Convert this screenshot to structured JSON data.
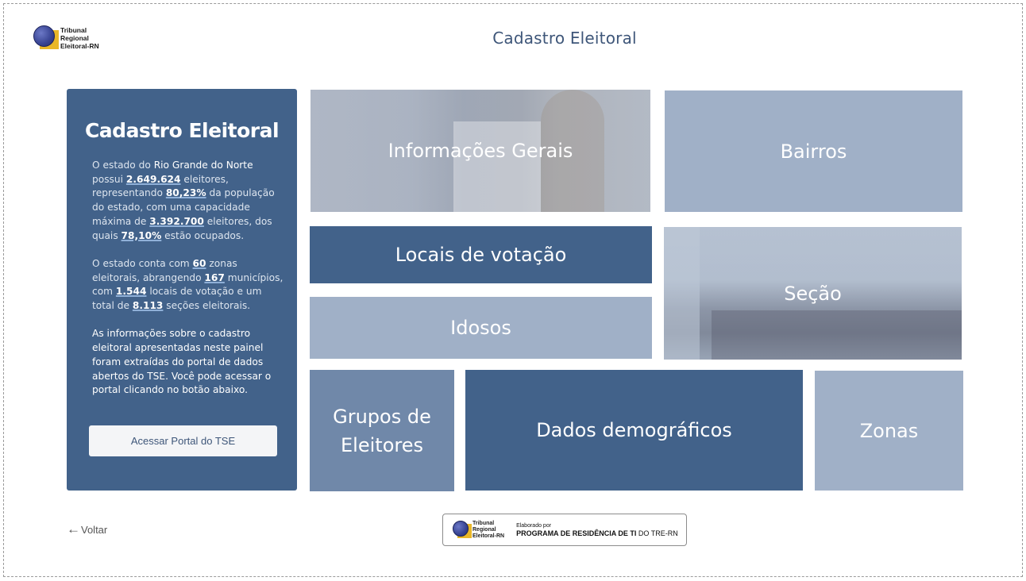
{
  "header": {
    "logo_lines": [
      "Tribunal",
      "Regional",
      "Eleitoral-RN"
    ],
    "title": "Cadastro Eleitoral"
  },
  "info_panel": {
    "title": "Cadastro Eleitoral",
    "p1": {
      "t1": "O estado do ",
      "state": "Rio Grande do Norte",
      "t2": " possui ",
      "voters": "2.649.624",
      "t3": " eleitores, representando ",
      "pct_population": "80,23%",
      "t4": " da população do estado, com uma capacidade máxima de ",
      "capacity": "3.392.700",
      "t5": " eleitores, dos quais ",
      "pct_occupied": "78,10%",
      "t6": " estão ocupados."
    },
    "p2": {
      "t1": "O estado conta com ",
      "zones": "60",
      "t2": " zonas eleitorais, abrangendo ",
      "municipalities": "167",
      "t3": " municípios, com ",
      "locations": "1.544",
      "t4": " locais de votação e um total de ",
      "sections": "8.113",
      "t5": " seções eleitorais."
    },
    "p3": "As informações sobre o cadastro eleitoral apresentadas neste painel foram extraídas do portal de dados abertos do TSE. Você pode acessar o portal clicando no botão abaixo.",
    "button_label": "Acessar Portal do TSE"
  },
  "tiles": {
    "informacoes_gerais": "Informações Gerais",
    "bairros": "Bairros",
    "locais_votacao": "Locais de votação",
    "secao": "Seção",
    "idosos": "Idosos",
    "grupos_eleitores_l1": "Grupos de",
    "grupos_eleitores_l2": "Eleitores",
    "dados_demograficos": "Dados demográficos",
    "zonas": "Zonas"
  },
  "footer": {
    "back_label": "Voltar",
    "credit_org_lines": [
      "Tribunal",
      "Regional",
      "Eleitoral-RN"
    ],
    "credit_small": "Elaborado por",
    "credit_bold": "PROGRAMA DE RESIDÊNCIA DE TI",
    "credit_rest": " DO TRE-RN"
  },
  "colors": {
    "dark_blue": "#42628a",
    "light_blue": "#a0b0c7",
    "mid_blue": "#7088a9",
    "title_blue": "#3e5679"
  }
}
